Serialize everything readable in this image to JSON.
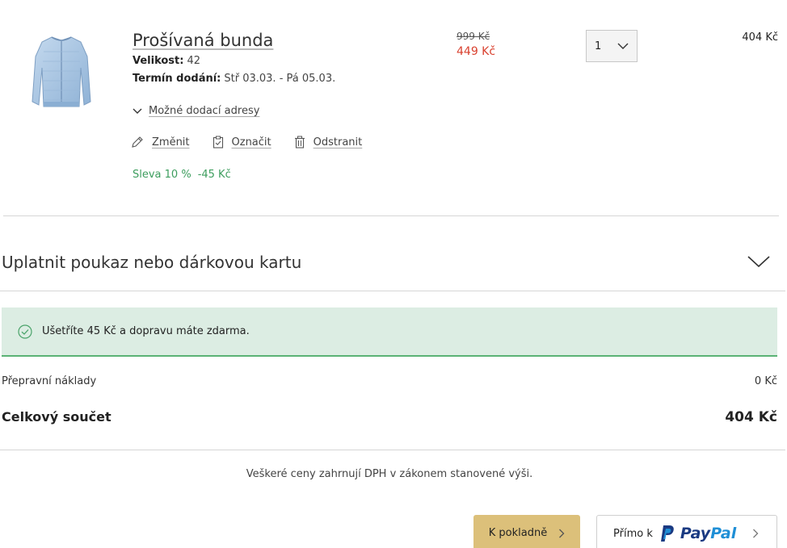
{
  "product": {
    "title": "Prošívaná bunda",
    "size_label": "Velikost:",
    "size_value": "42",
    "delivery_label": "Termín dodání:",
    "delivery_value": "Stř 03.03. - Pá 05.03.",
    "address_toggle": "Možné dodací adresy",
    "actions": {
      "edit": "Změnit",
      "mark": "Označit",
      "remove": "Odstranit"
    },
    "discount_label": "Sleva 10 %",
    "discount_value": "-45 Kč",
    "price_old": "999 Kč",
    "price_new": "449 Kč",
    "quantity": "1",
    "line_total": "404 Kč",
    "image_color": "#a9c6e2"
  },
  "voucher": {
    "label": "Uplatnit poukaz nebo dárkovou kartu"
  },
  "notice": {
    "text": "Ušetříte 45 Kč a dopravu máte zdarma."
  },
  "summary": {
    "shipping_label": "Přepravní náklady",
    "shipping_value": "0 Kč",
    "total_label": "Celkový součet",
    "total_value": "404 Kč",
    "vat_note": "Veškeré ceny zahrnují DPH v zákonem stanovené výši."
  },
  "buttons": {
    "checkout": "K pokladně",
    "paypal_prefix": "Přímo k",
    "paypal_pay": "Pay",
    "paypal_pal": "Pal"
  },
  "colors": {
    "accent_green": "#3c9d5d",
    "price_red": "#d9412f",
    "checkout_bg": "#dcc07a",
    "notice_bg": "#dcede3"
  }
}
